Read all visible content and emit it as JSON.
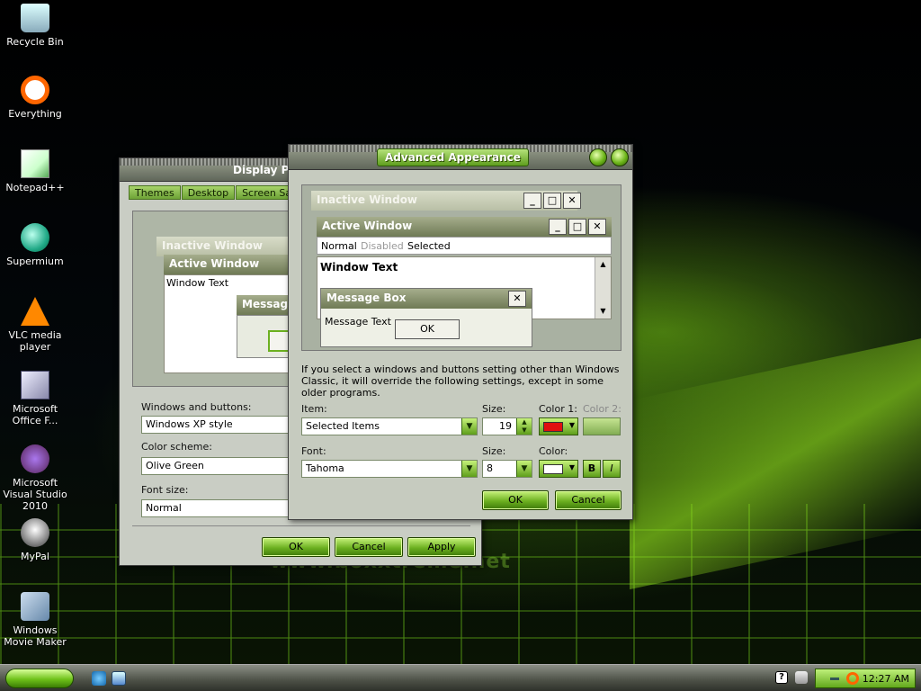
{
  "desktop": {
    "watermark": "www.boxxtreme.net",
    "icons": [
      {
        "label": "Recycle Bin",
        "icon": "recycle-bin-icon"
      },
      {
        "label": "Everything",
        "icon": "everything-search-icon"
      },
      {
        "label": "Notepad++",
        "icon": "notepad-plus-plus-icon"
      },
      {
        "label": "Supermium",
        "icon": "supermium-browser-icon"
      },
      {
        "label": "VLC media player",
        "icon": "vlc-cone-icon"
      },
      {
        "label": "Microsoft Office F...",
        "icon": "microsoft-office-icon"
      },
      {
        "label": "Microsoft Visual Studio 2010",
        "icon": "visual-studio-icon"
      },
      {
        "label": "MyPal",
        "icon": "mypal-browser-icon"
      },
      {
        "label": "Windows Movie Maker",
        "icon": "movie-maker-icon"
      }
    ]
  },
  "display_properties": {
    "title": "Display Pro",
    "tabs": [
      "Themes",
      "Desktop",
      "Screen Saver"
    ],
    "preview": {
      "inactive_title": "Inactive Window",
      "active_title": "Active Window",
      "window_text": "Window Text",
      "message_title": "Message"
    },
    "windows_buttons_label": "Windows and buttons:",
    "windows_buttons_value": "Windows XP style",
    "color_scheme_label": "Color scheme:",
    "color_scheme_value": "Olive Green",
    "font_size_label": "Font size:",
    "font_size_value": "Normal",
    "ok": "OK",
    "cancel": "Cancel",
    "apply": "Apply"
  },
  "advanced_appearance": {
    "title": "Advanced Appearance",
    "preview": {
      "inactive_title": "Inactive Window",
      "active_title": "Active Window",
      "menu_normal": "Normal",
      "menu_disabled": "Disabled",
      "menu_selected": "Selected",
      "window_text": "Window Text",
      "message_box_title": "Message Box",
      "message_text": "Message Text",
      "message_ok": "OK"
    },
    "info_text": "If you select a windows and buttons setting other than Windows Classic, it will override the following settings, except in some older programs.",
    "item_label": "Item:",
    "item_value": "Selected Items",
    "size_label": "Size:",
    "size_value": "19",
    "color1_label": "Color 1:",
    "color2_label": "Color 2:",
    "font_label": "Font:",
    "font_value": "Tahoma",
    "font_size_label": "Size:",
    "font_size_value": "8",
    "font_color_label": "Color:",
    "bold_label": "B",
    "italic_label": "I",
    "ok": "OK",
    "cancel": "Cancel",
    "colors": {
      "color1": "#e01010",
      "font_color": "#ffffff"
    }
  },
  "taskbar": {
    "clock": "12:27 AM"
  }
}
